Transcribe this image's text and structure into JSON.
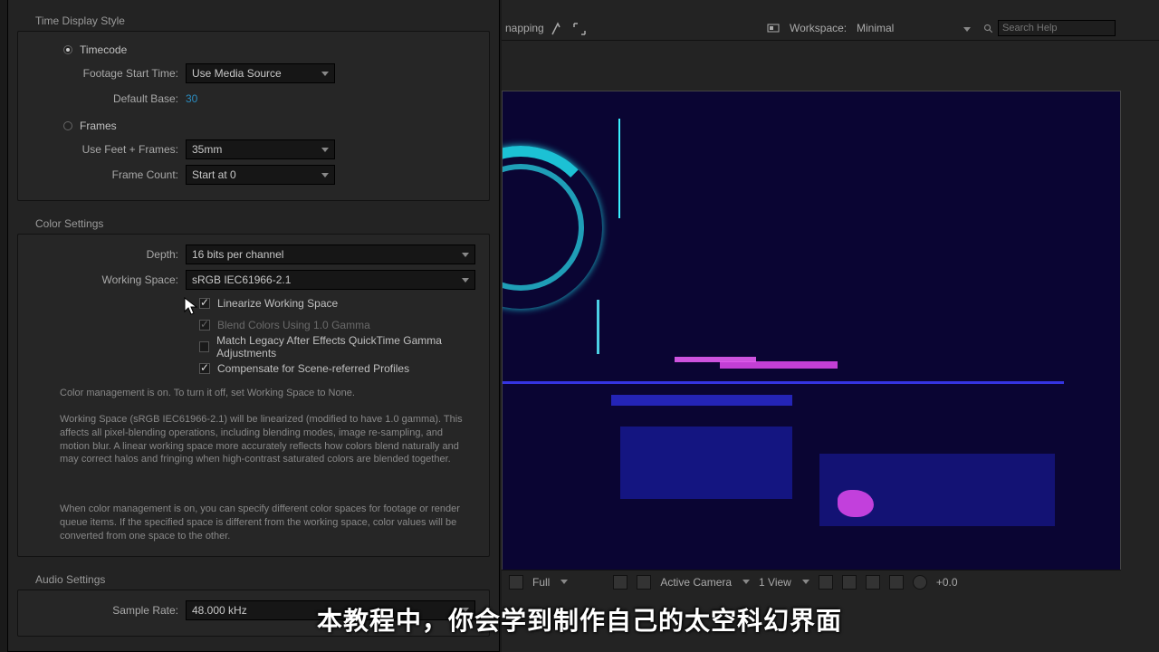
{
  "topbar": {
    "snapping": "napping",
    "workspace_label": "Workspace:",
    "workspace_value": "Minimal",
    "search_placeholder": "Search Help"
  },
  "time_display": {
    "title": "Time Display Style",
    "timecode_label": "Timecode",
    "footage_start_label": "Footage Start Time:",
    "footage_start_value": "Use Media Source",
    "default_base_label": "Default Base:",
    "default_base_value": "30",
    "frames_label": "Frames",
    "feet_frames_label": "Use Feet + Frames:",
    "feet_frames_value": "35mm",
    "frame_count_label": "Frame Count:",
    "frame_count_value": "Start at 0"
  },
  "color": {
    "title": "Color Settings",
    "depth_label": "Depth:",
    "depth_value": "16 bits per channel",
    "working_space_label": "Working Space:",
    "working_space_value": "sRGB IEC61966-2.1",
    "linearize": "Linearize Working Space",
    "blend": "Blend Colors Using 1.0 Gamma",
    "match_legacy": "Match Legacy After Effects QuickTime Gamma Adjustments",
    "compensate": "Compensate for Scene-referred Profiles",
    "info1": "Color management is on. To turn it off, set Working Space to None.",
    "info2": "Working Space (sRGB IEC61966-2.1) will be linearized (modified to have 1.0 gamma). This affects all pixel-blending operations, including blending modes, image re-sampling, and motion blur. A linear working space more accurately reflects how colors blend naturally and may correct halos and fringing when high-contrast saturated colors are blended together.",
    "info3": "When color management is on, you can specify different color spaces for footage or render queue items. If the specified space is different from the working space, color values will be converted from one space to the other."
  },
  "audio": {
    "title": "Audio Settings",
    "sample_rate_label": "Sample Rate:",
    "sample_rate_value": "48.000 kHz"
  },
  "viewer_bar": {
    "res": "Full",
    "camera": "Active Camera",
    "view": "1 View",
    "exposure": "+0.0"
  },
  "subtitle": "本教程中，你会学到制作自己的太空科幻界面"
}
